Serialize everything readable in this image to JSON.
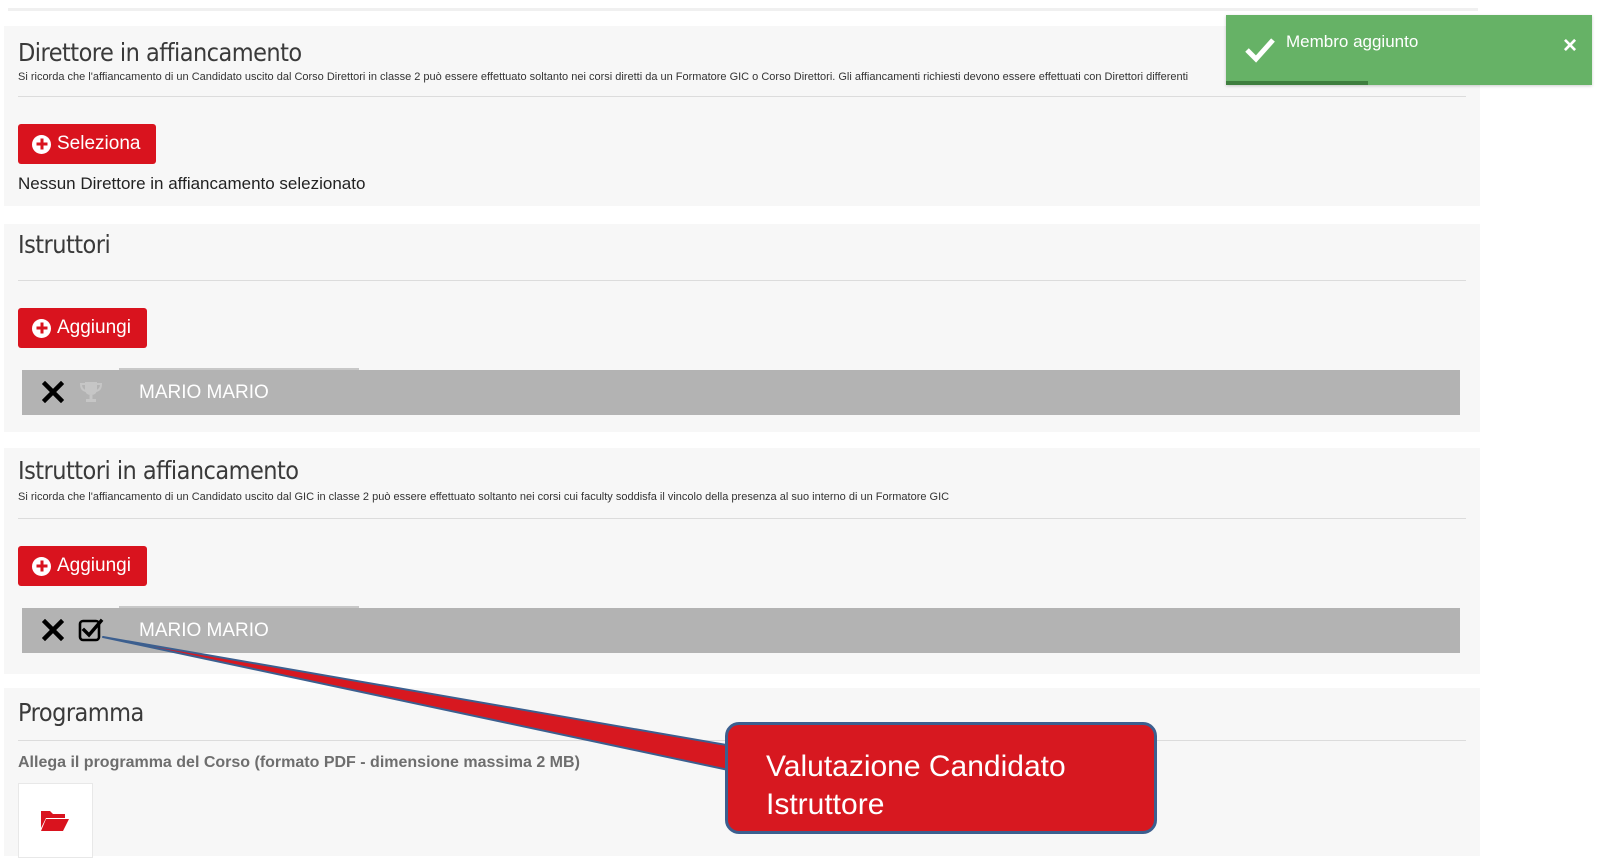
{
  "sections": {
    "direttore": {
      "title": "Direttore in affiancamento",
      "note": "Si ricorda che l'affiancamento di un Candidato uscito dal Corso Direttori in classe 2 può essere effettuato soltanto nei corsi diretti da un Formatore GIC o Corso Direttori. Gli affiancamenti richiesti devono essere effettuati con Direttori differenti",
      "button_label": "Seleziona",
      "empty_text": "Nessun Direttore in affiancamento selezionato"
    },
    "istruttori": {
      "title": "Istruttori",
      "button_label": "Aggiungi",
      "members": [
        {
          "name": "MARIO MARIO"
        }
      ]
    },
    "istruttori_affiancamento": {
      "title": "Istruttori in affiancamento",
      "note": "Si ricorda che l'affiancamento di un Candidato uscito dal GIC in classe 2 può essere effettuato soltanto nei corsi cui faculty soddisfa il vincolo della presenza al suo interno di un Formatore GIC",
      "button_label": "Aggiungi",
      "members": [
        {
          "name": "MARIO MARIO"
        }
      ]
    },
    "programma": {
      "title": "Programma",
      "attach_label": "Allega il programma del Corso (formato PDF - dimensione massima 2 MB)"
    }
  },
  "toast": {
    "message": "Membro aggiunto",
    "close": "×"
  },
  "callout": {
    "line1": "Valutazione Candidato",
    "line2": "Istruttore"
  },
  "colors": {
    "accent_red": "#d9131e",
    "toast_green": "#66b266",
    "row_gray": "#b3b3b3",
    "callout_border": "#3c5f8f"
  },
  "icons": [
    "plus-circle-icon",
    "remove-x-icon",
    "trophy-icon",
    "checkbox-checked-icon",
    "folder-open-icon",
    "checkmark-icon"
  ]
}
